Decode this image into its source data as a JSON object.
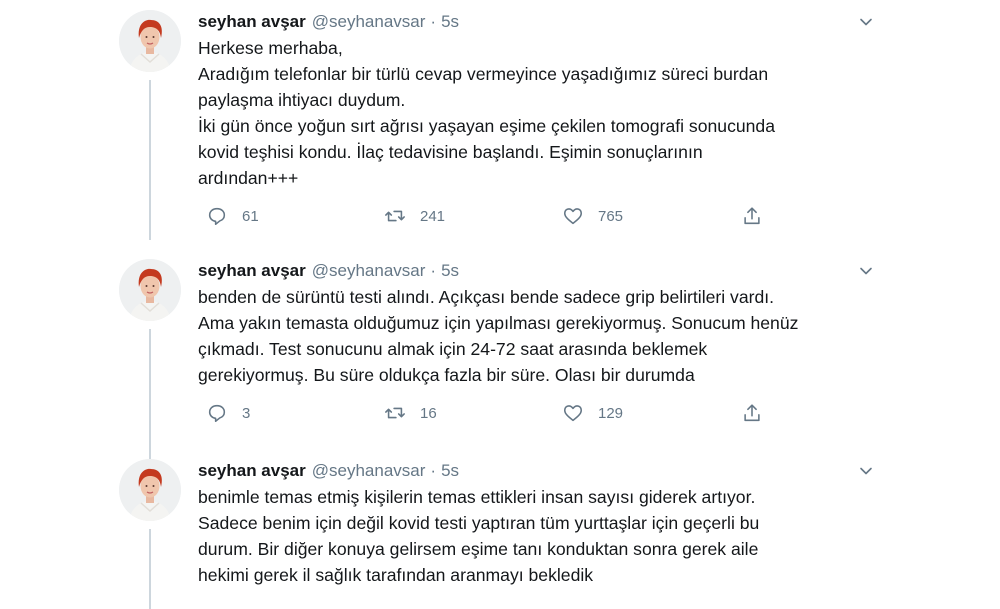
{
  "tweets": [
    {
      "name": "seyhan avşar",
      "handle": "@seyhanavsar",
      "dot": "·",
      "time": "5s",
      "lines": [
        "Herkese merhaba,",
        "Aradığım telefonlar bir türlü cevap vermeyince yaşadığımız süreci burdan",
        "paylaşma ihtiyacı duydum.",
        "İki gün önce yoğun sırt ağrısı yaşayan eşime çekilen tomografi sonucunda",
        "kovid teşhisi kondu. İlaç tedavisine başlandı. Eşimin sonuçlarının",
        "ardından+++"
      ],
      "replies": "61",
      "retweets": "241",
      "likes": "765"
    },
    {
      "name": "seyhan avşar",
      "handle": "@seyhanavsar",
      "dot": "·",
      "time": "5s",
      "lines": [
        "benden de sürüntü testi alındı. Açıkçası bende sadece grip belirtileri vardı.",
        "Ama yakın temasta olduğumuz için yapılması gerekiyormuş. Sonucum henüz",
        "çıkmadı. Test sonucunu almak için 24-72 saat arasında beklemek",
        "gerekiyormuş. Bu süre oldukça fazla bir süre. Olası bir durumda"
      ],
      "replies": "3",
      "retweets": "16",
      "likes": "129"
    },
    {
      "name": "seyhan avşar",
      "handle": "@seyhanavsar",
      "dot": "·",
      "time": "5s",
      "lines": [
        "benimle temas etmiş kişilerin temas ettikleri insan sayısı giderek artıyor.",
        "Sadece benim için değil kovid testi yaptıran tüm yurttaşlar için geçerli bu",
        "durum. Bir diğer konuya gelirsem eşime tanı konduktan sonra gerek aile",
        "hekimi gerek il sağlık tarafından aranmayı bekledik"
      ]
    }
  ],
  "icons": {
    "more": "chevron-down-icon",
    "reply": "reply-icon",
    "retweet": "retweet-icon",
    "like": "heart-icon",
    "share": "share-icon"
  },
  "colors": {
    "text": "#14171a",
    "secondary": "#657786",
    "thread_line": "#cdd6dd"
  }
}
